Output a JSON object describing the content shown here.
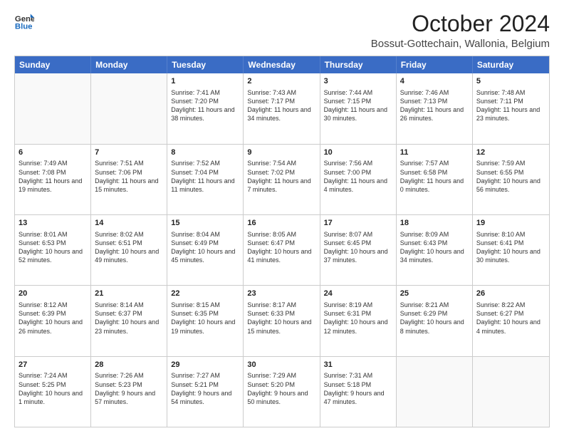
{
  "header": {
    "logo_line1": "General",
    "logo_line2": "Blue",
    "month": "October 2024",
    "location": "Bossut-Gottechain, Wallonia, Belgium"
  },
  "weekdays": [
    "Sunday",
    "Monday",
    "Tuesday",
    "Wednesday",
    "Thursday",
    "Friday",
    "Saturday"
  ],
  "rows": [
    [
      {
        "day": "",
        "sunrise": "",
        "sunset": "",
        "daylight": ""
      },
      {
        "day": "",
        "sunrise": "",
        "sunset": "",
        "daylight": ""
      },
      {
        "day": "1",
        "sunrise": "Sunrise: 7:41 AM",
        "sunset": "Sunset: 7:20 PM",
        "daylight": "Daylight: 11 hours and 38 minutes."
      },
      {
        "day": "2",
        "sunrise": "Sunrise: 7:43 AM",
        "sunset": "Sunset: 7:17 PM",
        "daylight": "Daylight: 11 hours and 34 minutes."
      },
      {
        "day": "3",
        "sunrise": "Sunrise: 7:44 AM",
        "sunset": "Sunset: 7:15 PM",
        "daylight": "Daylight: 11 hours and 30 minutes."
      },
      {
        "day": "4",
        "sunrise": "Sunrise: 7:46 AM",
        "sunset": "Sunset: 7:13 PM",
        "daylight": "Daylight: 11 hours and 26 minutes."
      },
      {
        "day": "5",
        "sunrise": "Sunrise: 7:48 AM",
        "sunset": "Sunset: 7:11 PM",
        "daylight": "Daylight: 11 hours and 23 minutes."
      }
    ],
    [
      {
        "day": "6",
        "sunrise": "Sunrise: 7:49 AM",
        "sunset": "Sunset: 7:08 PM",
        "daylight": "Daylight: 11 hours and 19 minutes."
      },
      {
        "day": "7",
        "sunrise": "Sunrise: 7:51 AM",
        "sunset": "Sunset: 7:06 PM",
        "daylight": "Daylight: 11 hours and 15 minutes."
      },
      {
        "day": "8",
        "sunrise": "Sunrise: 7:52 AM",
        "sunset": "Sunset: 7:04 PM",
        "daylight": "Daylight: 11 hours and 11 minutes."
      },
      {
        "day": "9",
        "sunrise": "Sunrise: 7:54 AM",
        "sunset": "Sunset: 7:02 PM",
        "daylight": "Daylight: 11 hours and 7 minutes."
      },
      {
        "day": "10",
        "sunrise": "Sunrise: 7:56 AM",
        "sunset": "Sunset: 7:00 PM",
        "daylight": "Daylight: 11 hours and 4 minutes."
      },
      {
        "day": "11",
        "sunrise": "Sunrise: 7:57 AM",
        "sunset": "Sunset: 6:58 PM",
        "daylight": "Daylight: 11 hours and 0 minutes."
      },
      {
        "day": "12",
        "sunrise": "Sunrise: 7:59 AM",
        "sunset": "Sunset: 6:55 PM",
        "daylight": "Daylight: 10 hours and 56 minutes."
      }
    ],
    [
      {
        "day": "13",
        "sunrise": "Sunrise: 8:01 AM",
        "sunset": "Sunset: 6:53 PM",
        "daylight": "Daylight: 10 hours and 52 minutes."
      },
      {
        "day": "14",
        "sunrise": "Sunrise: 8:02 AM",
        "sunset": "Sunset: 6:51 PM",
        "daylight": "Daylight: 10 hours and 49 minutes."
      },
      {
        "day": "15",
        "sunrise": "Sunrise: 8:04 AM",
        "sunset": "Sunset: 6:49 PM",
        "daylight": "Daylight: 10 hours and 45 minutes."
      },
      {
        "day": "16",
        "sunrise": "Sunrise: 8:05 AM",
        "sunset": "Sunset: 6:47 PM",
        "daylight": "Daylight: 10 hours and 41 minutes."
      },
      {
        "day": "17",
        "sunrise": "Sunrise: 8:07 AM",
        "sunset": "Sunset: 6:45 PM",
        "daylight": "Daylight: 10 hours and 37 minutes."
      },
      {
        "day": "18",
        "sunrise": "Sunrise: 8:09 AM",
        "sunset": "Sunset: 6:43 PM",
        "daylight": "Daylight: 10 hours and 34 minutes."
      },
      {
        "day": "19",
        "sunrise": "Sunrise: 8:10 AM",
        "sunset": "Sunset: 6:41 PM",
        "daylight": "Daylight: 10 hours and 30 minutes."
      }
    ],
    [
      {
        "day": "20",
        "sunrise": "Sunrise: 8:12 AM",
        "sunset": "Sunset: 6:39 PM",
        "daylight": "Daylight: 10 hours and 26 minutes."
      },
      {
        "day": "21",
        "sunrise": "Sunrise: 8:14 AM",
        "sunset": "Sunset: 6:37 PM",
        "daylight": "Daylight: 10 hours and 23 minutes."
      },
      {
        "day": "22",
        "sunrise": "Sunrise: 8:15 AM",
        "sunset": "Sunset: 6:35 PM",
        "daylight": "Daylight: 10 hours and 19 minutes."
      },
      {
        "day": "23",
        "sunrise": "Sunrise: 8:17 AM",
        "sunset": "Sunset: 6:33 PM",
        "daylight": "Daylight: 10 hours and 15 minutes."
      },
      {
        "day": "24",
        "sunrise": "Sunrise: 8:19 AM",
        "sunset": "Sunset: 6:31 PM",
        "daylight": "Daylight: 10 hours and 12 minutes."
      },
      {
        "day": "25",
        "sunrise": "Sunrise: 8:21 AM",
        "sunset": "Sunset: 6:29 PM",
        "daylight": "Daylight: 10 hours and 8 minutes."
      },
      {
        "day": "26",
        "sunrise": "Sunrise: 8:22 AM",
        "sunset": "Sunset: 6:27 PM",
        "daylight": "Daylight: 10 hours and 4 minutes."
      }
    ],
    [
      {
        "day": "27",
        "sunrise": "Sunrise: 7:24 AM",
        "sunset": "Sunset: 5:25 PM",
        "daylight": "Daylight: 10 hours and 1 minute."
      },
      {
        "day": "28",
        "sunrise": "Sunrise: 7:26 AM",
        "sunset": "Sunset: 5:23 PM",
        "daylight": "Daylight: 9 hours and 57 minutes."
      },
      {
        "day": "29",
        "sunrise": "Sunrise: 7:27 AM",
        "sunset": "Sunset: 5:21 PM",
        "daylight": "Daylight: 9 hours and 54 minutes."
      },
      {
        "day": "30",
        "sunrise": "Sunrise: 7:29 AM",
        "sunset": "Sunset: 5:20 PM",
        "daylight": "Daylight: 9 hours and 50 minutes."
      },
      {
        "day": "31",
        "sunrise": "Sunrise: 7:31 AM",
        "sunset": "Sunset: 5:18 PM",
        "daylight": "Daylight: 9 hours and 47 minutes."
      },
      {
        "day": "",
        "sunrise": "",
        "sunset": "",
        "daylight": ""
      },
      {
        "day": "",
        "sunrise": "",
        "sunset": "",
        "daylight": ""
      }
    ]
  ]
}
